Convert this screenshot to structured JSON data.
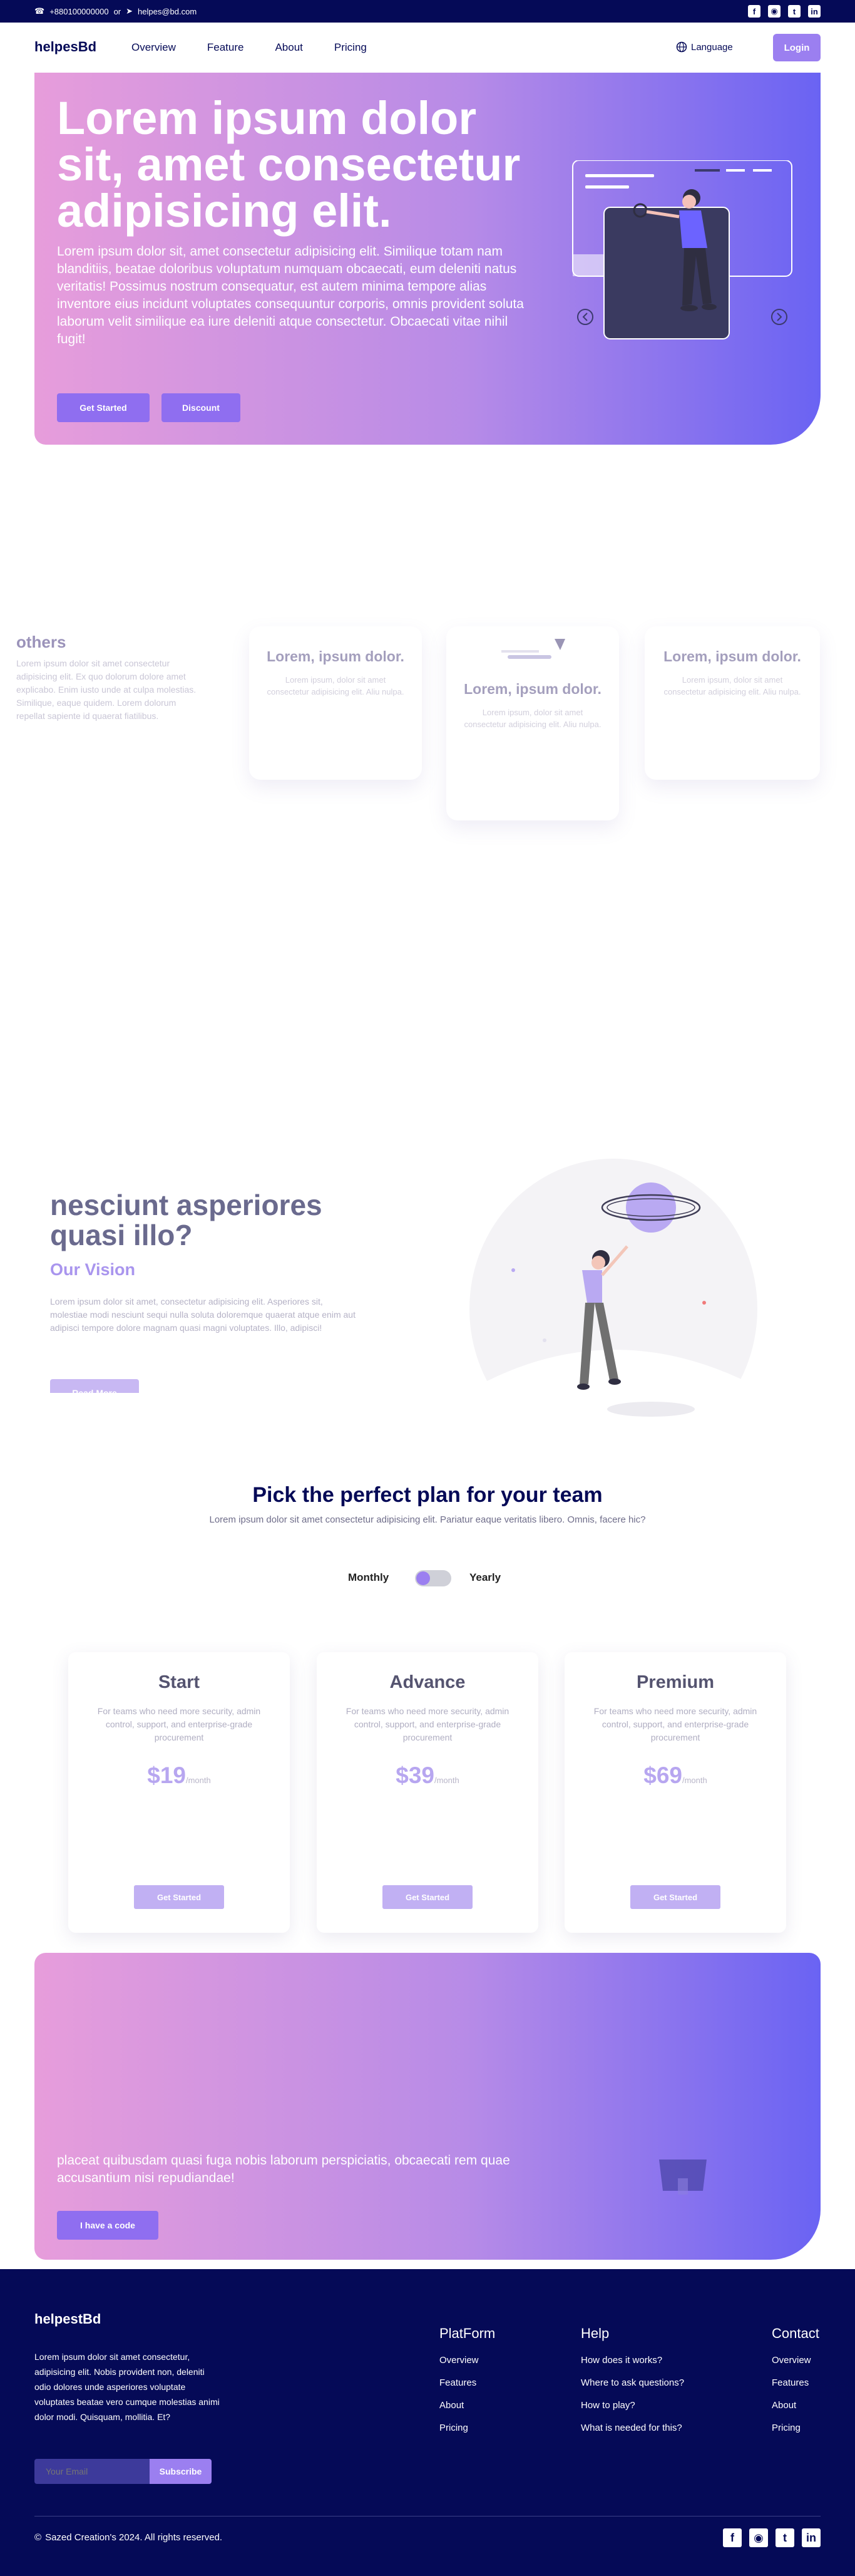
{
  "topbar": {
    "phone": "+880100000000",
    "separator": "or",
    "email": "helpes@bd.com",
    "socials": [
      "facebook-icon",
      "instagram-icon",
      "twitter-icon",
      "linkedin-icon"
    ]
  },
  "navbar": {
    "logo": "helpesBd",
    "links": [
      "Overview",
      "Feature",
      "About",
      "Pricing"
    ],
    "language": "Language",
    "login": "Login"
  },
  "hero": {
    "title": "Lorem ipsum dolor sit, amet consectetur adipisicing elit.",
    "text": "Lorem ipsum dolor sit, amet consectetur adipisicing elit. Similique totam nam blanditiis, beatae doloribus voluptatum numquam obcaecati, eum deleniti natus veritatis! Possimus nostrum consequatur, est autem minima tempore alias inventore eius incidunt voluptates consequuntur corporis, omnis provident soluta laborum velit similique ea iure deleniti atque consectetur. Obcaecati vitae nihil fugit!",
    "primary_button": "Get Started",
    "secondary_button": "Discount"
  },
  "services": {
    "intro_title": "others",
    "intro_text": "Lorem ipsum dolor sit amet consectetur adipisicing elit. Ex quo dolorum dolore amet explicabo. Enim iusto unde at culpa molestias. Similique, eaque quidem. Lorem dolorum repellat sapiente id quaerat fiatilibus.",
    "cards": [
      {
        "title": "Lorem, ipsum dolor.",
        "text": "Lorem ipsum, dolor sit amet consectetur adipisicing elit. Aliu nulpa."
      },
      {
        "title": "Lorem, ipsum dolor.",
        "text": "Lorem ipsum, dolor sit amet consectetur adipisicing elit. Aliu nulpa."
      },
      {
        "title": "Lorem, ipsum dolor.",
        "text": "Lorem ipsum, dolor sit amet consectetur adipisicing elit. Aliu nulpa."
      }
    ]
  },
  "vision": {
    "title": "nesciunt asperiores quasi illo?",
    "subtitle": "Our Vision",
    "text": "Lorem ipsum dolor sit amet, consectetur adipisicing elit. Asperiores sit, molestiae modi nesciunt sequi nulla soluta doloremque quaerat atque enim aut adipisci tempore dolore magnam quasi magni voluptates. Illo, adipisci!",
    "button": "Read More"
  },
  "pricing": {
    "title": "Pick the perfect plan for your team",
    "subtitle": "Lorem ipsum dolor sit amet consectetur adipisicing elit. Pariatur eaque veritatis libero. Omnis, facere hic?",
    "monthly": "Monthly",
    "yearly": "Yearly",
    "toggle_state": "monthly",
    "plans": [
      {
        "name": "Start",
        "desc": "For teams who need more security, admin control, support, and enterprise-grade procurement",
        "price": "$19",
        "period": "/month",
        "button": "Get Started"
      },
      {
        "name": "Advance",
        "desc": "For teams who need more security, admin control, support, and enterprise-grade procurement",
        "price": "$39",
        "period": "/month",
        "button": "Get Started"
      },
      {
        "name": "Premium",
        "desc": "For teams who need more security, admin control, support, and enterprise-grade procurement",
        "price": "$69",
        "period": "/month",
        "button": "Get Started"
      }
    ]
  },
  "cta": {
    "text": "placeat quibusdam quasi fuga nobis laborum perspiciatis, obcaecati rem quae accusantium nisi repudiandae!",
    "button": "I have a code"
  },
  "footer": {
    "logo": "helpestBd",
    "description": "Lorem ipsum dolor sit amet consectetur, adipisicing elit. Nobis provident non, deleniti odio dolores unde asperiores voluptate voluptates beatae vero cumque molestias animi dolor modi. Quisquam, mollitia. Et?",
    "email_placeholder": "Your Email",
    "subscribe": "Subscribe",
    "columns": [
      {
        "title": "PlatForm",
        "links": [
          "Overview",
          "Features",
          "About",
          "Pricing"
        ]
      },
      {
        "title": "Help",
        "links": [
          "How does it works?",
          "Where to ask questions?",
          "How to play?",
          "What is needed for this?"
        ]
      },
      {
        "title": "Contact",
        "links": [
          "Overview",
          "Features",
          "About",
          "Pricing"
        ]
      }
    ],
    "copyright": "Sazed Creation's 2024. All rights reserved."
  },
  "colors": {
    "navy": "#050a57",
    "purple": "#9b7ff0",
    "gradient_start": "#e79ddb",
    "gradient_end": "#6a63f3"
  }
}
